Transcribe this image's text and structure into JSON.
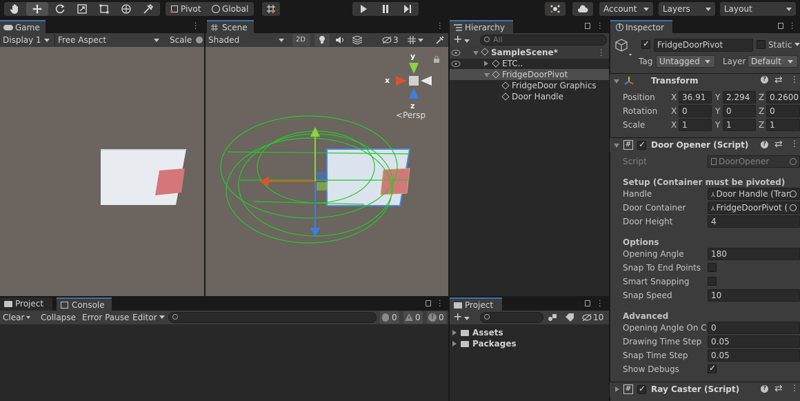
{
  "toolbar": {
    "pivot_label": "Pivot",
    "global_label": "Global",
    "account_label": "Account",
    "layers_label": "Layers",
    "layout_label": "Layout"
  },
  "game": {
    "tab_label": "Game",
    "display_label": "Display 1",
    "aspect_label": "Free Aspect",
    "scale_label": "Scale"
  },
  "scene": {
    "tab_label": "Scene",
    "shading_label": "Shaded",
    "mode_2d_label": "2D",
    "hidden_count": "3",
    "persp_label": "Persp",
    "axis_x": "x",
    "axis_y": "y",
    "axis_z": "z"
  },
  "hierarchy": {
    "tab_label": "Hierarchy",
    "search_placeholder": "All",
    "scene_name": "SampleScene*",
    "items": [
      {
        "label": "ETC.."
      },
      {
        "label": "FridgeDoorPivot"
      },
      {
        "label": "FridgeDoor Graphics"
      },
      {
        "label": "Door Handle"
      }
    ]
  },
  "inspector": {
    "tab_label": "Inspector",
    "object_name": "FridgeDoorPivot",
    "static_label": "Static",
    "tag_label": "Tag",
    "tag_value": "Untagged",
    "layer_label": "Layer",
    "layer_value": "Default",
    "transform": {
      "title": "Transform",
      "position_label": "Position",
      "rotation_label": "Rotation",
      "scale_label": "Scale",
      "axis_x": "X",
      "axis_y": "Y",
      "axis_z": "Z",
      "position": [
        "36.91",
        "2.294",
        "0.2600"
      ],
      "rotation": [
        "0",
        "0",
        "0"
      ],
      "scale": [
        "1",
        "1",
        "1"
      ]
    },
    "door_opener": {
      "title": "Door Opener (Script)",
      "script_label": "Script",
      "script_value": "DoorOpener",
      "setup_header": "Setup (Container must be pivoted)",
      "handle_label": "Handle",
      "handle_value": "Door Handle (Tran",
      "container_label": "Door Container",
      "container_value": "FridgeDoorPivot (",
      "height_label": "Door Height",
      "height_value": "4",
      "options_header": "Options",
      "opening_angle_label": "Opening Angle",
      "opening_angle_value": "180",
      "snap_end_label": "Snap To End Points",
      "smart_snap_label": "Smart Snapping",
      "snap_speed_label": "Snap Speed",
      "snap_speed_value": "10",
      "advanced_header": "Advanced",
      "angle_click_label": "Opening Angle On Cli",
      "angle_click_value": "0",
      "draw_step_label": "Drawing Time Step",
      "draw_step_value": "0.05",
      "snap_step_label": "Snap Time Step",
      "snap_step_value": "0.05",
      "debugs_label": "Show Debugs"
    },
    "ray_caster": {
      "title": "Ray Caster (Script)"
    }
  },
  "console": {
    "project_tab": "Project",
    "console_tab": "Console",
    "clear_label": "Clear",
    "collapse_label": "Collapse",
    "error_pause_label": "Error Pause",
    "editor_label": "Editor",
    "log_count": "0",
    "warn_count": "0",
    "error_count": "0"
  },
  "project": {
    "tab_label": "Project",
    "hidden_count": "10",
    "folders": [
      {
        "label": "Assets"
      },
      {
        "label": "Packages"
      }
    ]
  },
  "colors": {
    "accent": "#3a72b0",
    "gizmo_green": "#27c927",
    "axis_red": "#e0502a",
    "axis_green": "#8ad440",
    "axis_blue": "#3b7fe0"
  }
}
